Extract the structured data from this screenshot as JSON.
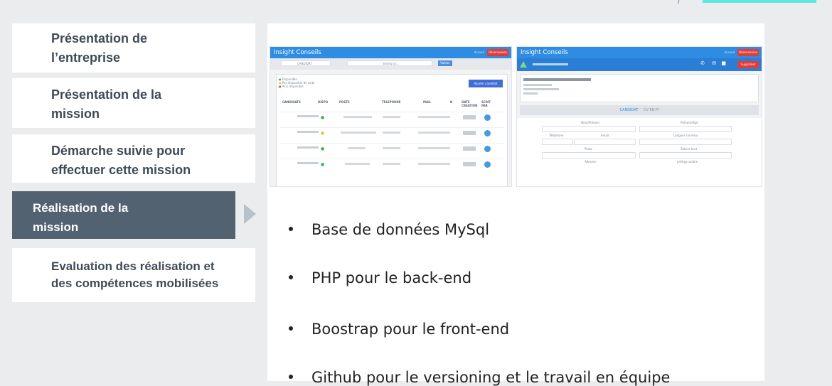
{
  "nav": {
    "items": [
      {
        "line1": "Présentation de",
        "line2": "l’entreprise"
      },
      {
        "line1": "Présentation de la",
        "line2": "mission"
      },
      {
        "line1": "Démarche suivie pour",
        "line2": "effectuer cette mission"
      },
      {
        "line1": "Réalisation de la",
        "line2": "mission"
      },
      {
        "line1": "Evaluation des réalisation et",
        "line2": "des compétences mobilisées"
      }
    ]
  },
  "screens": {
    "left": {
      "app_title": "Insight Conseils",
      "nav_link": "Accueil",
      "logout_label": "Déconnexion",
      "filter_select": "CANDIDAT",
      "search_placeholder": "Entrez ici...",
      "validate_label": "Valider",
      "legend": [
        "Disponible",
        "Pas disponible de suite",
        "Plus disponible"
      ],
      "add_label": "Ajouter candidat",
      "table_headers": [
        "CANDIDATS",
        "DISPO",
        "POSTE",
        "TELEPHONE",
        "MAIL",
        "N",
        "DATE CREATION",
        "SCRIT PAR"
      ]
    },
    "right": {
      "app_title": "Insight Conseils",
      "nav_link": "Accueil",
      "logout_label": "Déconnexion",
      "delete_label": "Supprimer",
      "tab_candidat": "CANDIDAT",
      "tab_cv": "CV EN PI",
      "form_labels": [
        "Nom/Prénom",
        "Prénom/Age",
        "Téléphone",
        "Email",
        "Langues (niveau)",
        "Poste",
        "Salaire brut",
        "Adresse",
        "préttge salaire"
      ]
    }
  },
  "bullets": [
    "Base de données MySql",
    "PHP pour le back-end",
    "Boostrap pour le front-end",
    "Github pour le versioning et le travail en équipe"
  ],
  "colors": {
    "background": "#ebecee",
    "nav_active": "#536271",
    "nav_text": "#3f4a57",
    "accent_cyan": "#5de8e3",
    "app_blue": "#2e8ce3"
  }
}
